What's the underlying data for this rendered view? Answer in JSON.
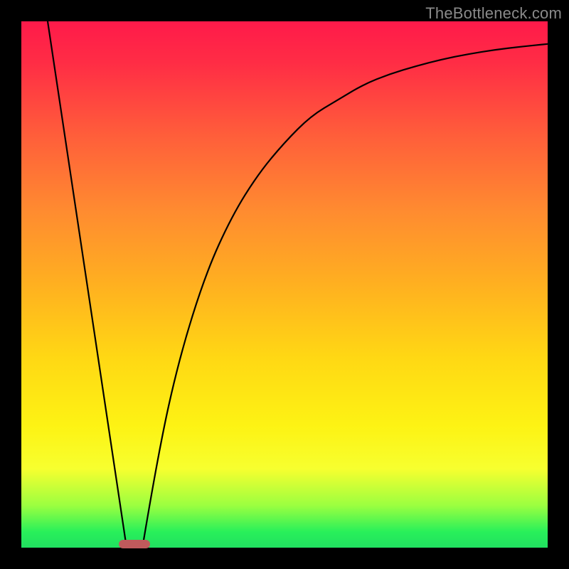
{
  "watermark": "TheBottleneck.com",
  "chart_data": {
    "type": "line",
    "title": "",
    "xlabel": "",
    "ylabel": "",
    "xlim": [
      0,
      100
    ],
    "ylim": [
      0,
      100
    ],
    "grid": false,
    "legend": false,
    "series": [
      {
        "name": "left-descending-line",
        "x": [
          5,
          20
        ],
        "y": [
          100,
          0
        ]
      },
      {
        "name": "right-rising-curve",
        "x": [
          23,
          26,
          30,
          35,
          40,
          45,
          50,
          55,
          60,
          65,
          70,
          75,
          80,
          85,
          90,
          95,
          100
        ],
        "y": [
          0,
          18,
          36,
          52,
          63,
          71,
          77,
          82,
          85,
          88,
          90,
          91.5,
          92.8,
          93.8,
          94.6,
          95.2,
          95.7
        ]
      }
    ],
    "marker": {
      "name": "sweet-spot-marker",
      "x": 21.5,
      "width": 6,
      "y": 0,
      "color": "#c05a5c"
    },
    "gradient_colors": {
      "top": "#ff1a4a",
      "mid_upper": "#ff8b30",
      "mid": "#ffd814",
      "mid_lower": "#f7ff2f",
      "bottom": "#21e060"
    }
  }
}
